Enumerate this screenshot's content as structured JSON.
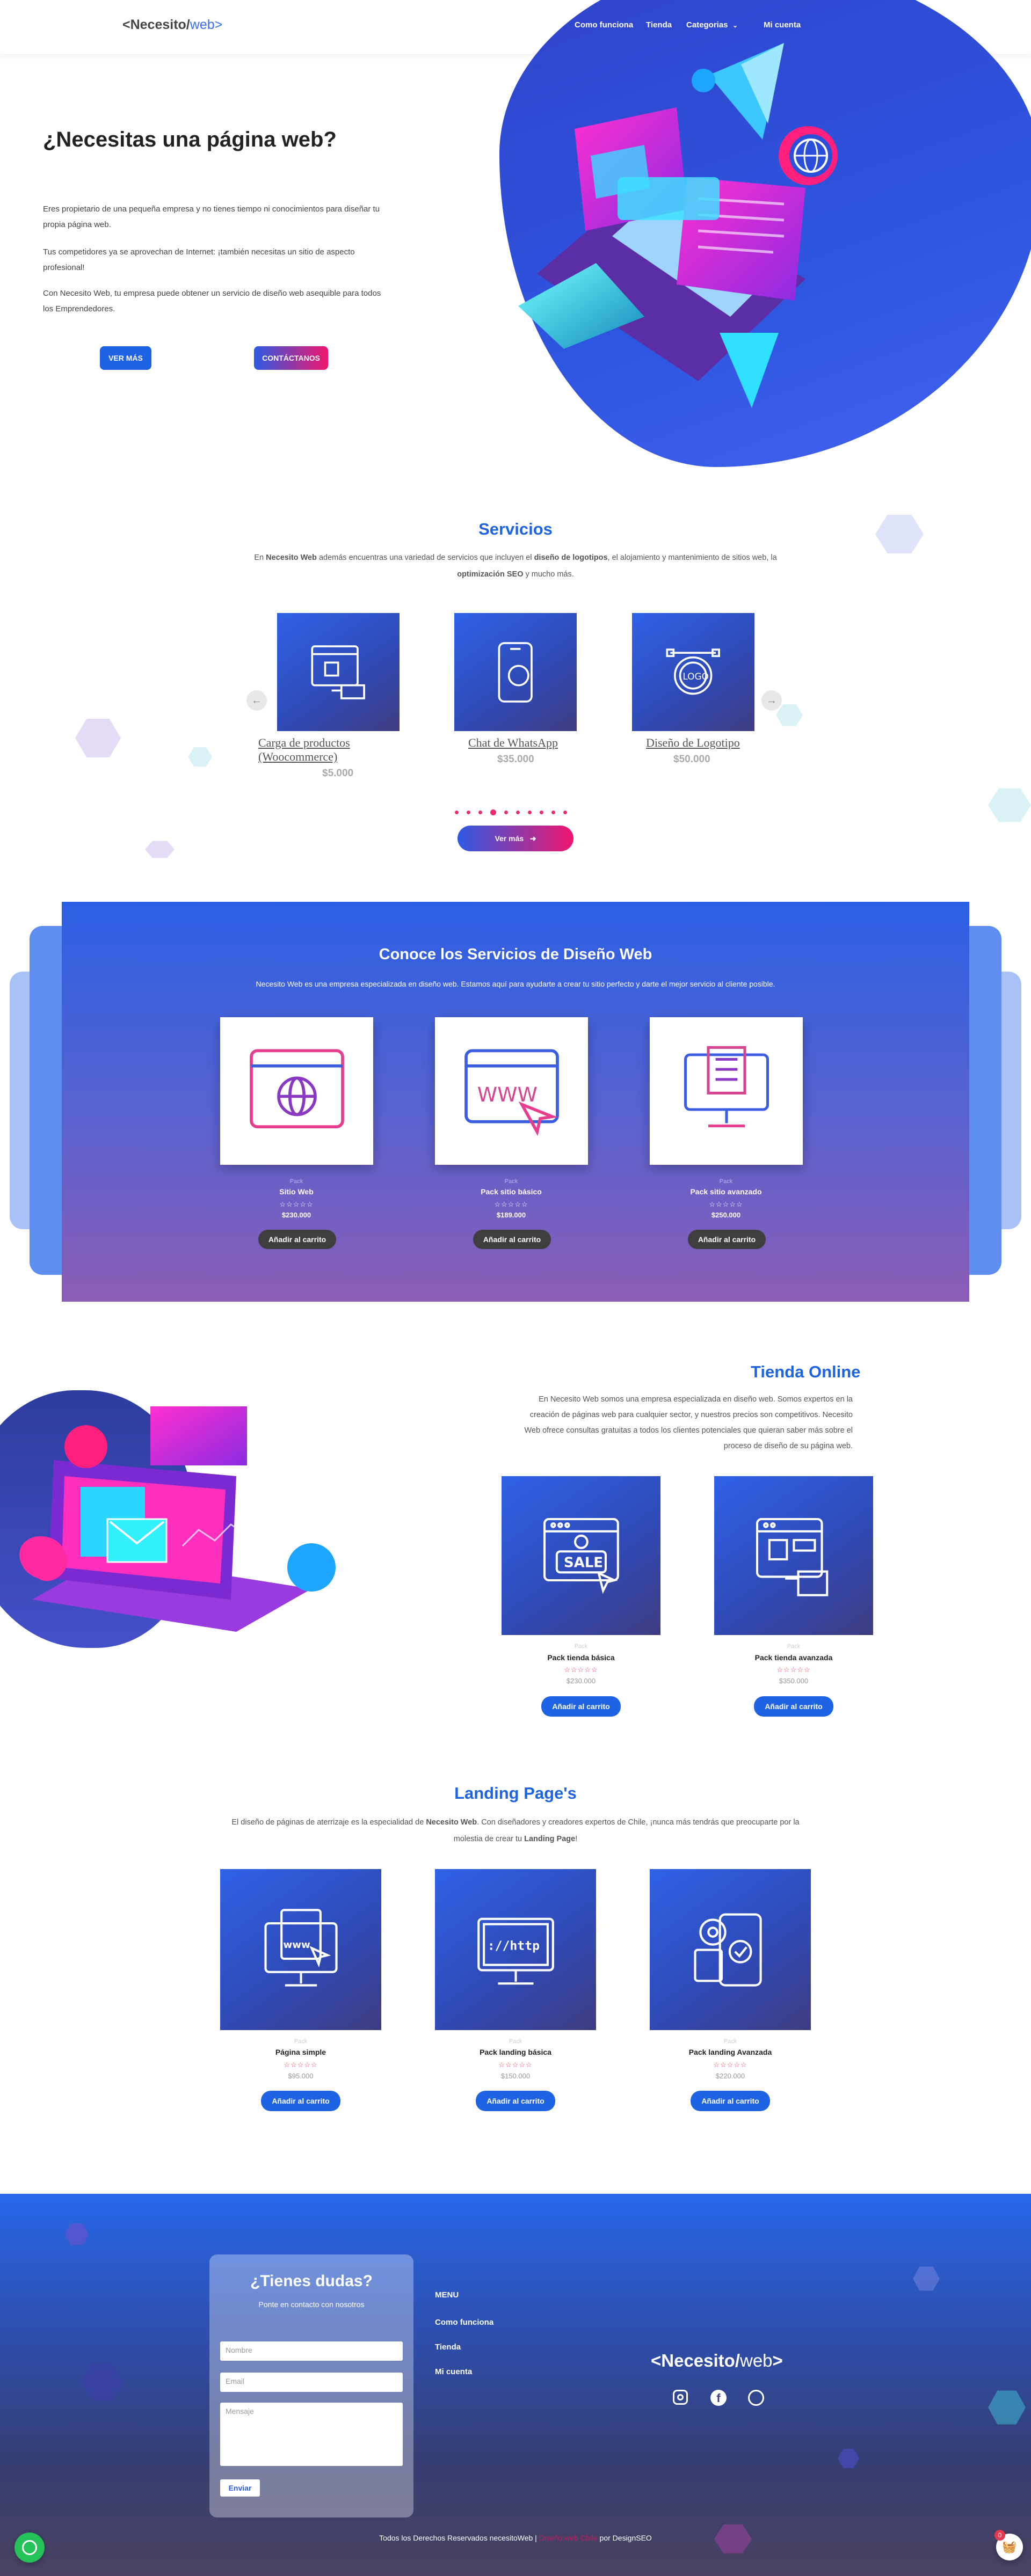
{
  "header": {
    "logo_main": "<Necesito/",
    "logo_web": "web",
    "logo_end": ">",
    "nav": [
      "Como funciona",
      "Tienda",
      "Categorias",
      "Mi cuenta"
    ]
  },
  "hero": {
    "title": "¿Necesitas una página web?",
    "p1": "Eres propietario de una pequeña empresa y no tienes tiempo ni conocimientos para diseñar tu propia página web.",
    "p2": "Tus competidores ya se aprovechan de Internet: ¡también necesitas un sitio de aspecto profesional!",
    "p3": "Con Necesito Web, tu empresa puede obtener un servicio de diseño web asequible para todos los Emprendedores.",
    "btn_more": "VER MÁS",
    "btn_contact": "CONTÁCTANOS"
  },
  "servicios": {
    "title": "Servicios",
    "desc_a": "En ",
    "desc_b": "Necesito Web",
    "desc_c": " además encuentras una variedad de servicios que incluyen el ",
    "desc_d": "diseño de logotipos",
    "desc_e": ", el alojamiento y mantenimiento de sitios web, la",
    "desc_f": "optimización SEO",
    "desc_g": " y mucho más.",
    "items": [
      {
        "name": "Carga de productos (Woocommerce)",
        "price": "$5.000",
        "icon": "shopping-hand-icon"
      },
      {
        "name": "Chat de WhatsApp",
        "price": "$35.000",
        "icon": "whatsapp-phone-icon"
      },
      {
        "name": "Diseño de Logotipo",
        "price": "$50.000",
        "icon": "logo-design-icon"
      }
    ],
    "btn": "Ver más"
  },
  "conoce": {
    "title": "Conoce los Servicios de Diseño Web",
    "desc": "Necesito Web es una empresa especializada en diseño web. Estamos aquí para ayudarte a crear tu sitio perfecto y darte el mejor servicio al cliente posible.",
    "products": [
      {
        "cat": "Pack",
        "name": "Sitio Web",
        "stars": "☆☆☆☆☆",
        "price": "$230.000",
        "btn": "Añadir al carrito",
        "icon": "browser-globe-icon"
      },
      {
        "cat": "Pack",
        "name": "Pack sitio básico",
        "stars": "☆☆☆☆☆",
        "price": "$189.000",
        "btn": "Añadir al carrito",
        "icon": "www-cursor-icon"
      },
      {
        "cat": "Pack",
        "name": "Pack sitio avanzado",
        "stars": "☆☆☆☆☆",
        "price": "$250.000",
        "btn": "Añadir al carrito",
        "icon": "monitor-checklist-icon"
      }
    ]
  },
  "tienda": {
    "title": "Tienda Online",
    "desc": "En Necesito Web somos una empresa especializada en diseño web. Somos expertos en la creación de páginas web para cualquier sector, y nuestros precios son competitivos. Necesito Web ofrece consultas gratuitas a todos los clientes potenciales que quieran saber más sobre el proceso de diseño de su página web.",
    "products": [
      {
        "cat": "Pack",
        "name": "Pack tienda básica",
        "stars": "☆☆☆☆☆",
        "price": "$230.000",
        "btn": "Añadir al carrito",
        "icon": "sale-browser-icon"
      },
      {
        "cat": "Pack",
        "name": "Pack tienda avanzada",
        "stars": "☆☆☆☆☆",
        "price": "$350.000",
        "btn": "Añadir al carrito",
        "icon": "shopping-browser-icon"
      }
    ]
  },
  "landing": {
    "title": "Landing Page's",
    "desc_a": "El diseño de páginas de aterrizaje es la especialidad de ",
    "desc_b": "Necesito Web",
    "desc_c": ". Con diseñadores y creadores expertos de Chile, ¡nunca más tendrás que preocuparte por la",
    "desc_d": "molestia de crear tu ",
    "desc_e": "Landing Page",
    "desc_f": "!",
    "products": [
      {
        "cat": "Pack",
        "name": "Página simple",
        "stars": "☆☆☆☆☆",
        "price": "$95.000",
        "btn": "Añadir al carrito",
        "icon": "monitor-www-icon"
      },
      {
        "cat": "Pack",
        "name": "Pack landing básica",
        "stars": "☆☆☆☆☆",
        "price": "$150.000",
        "btn": "Añadir al carrito",
        "icon": "monitor-http-icon"
      },
      {
        "cat": "Pack",
        "name": "Pack landing Avanzada",
        "stars": "☆☆☆☆☆",
        "price": "$220.000",
        "btn": "Añadir al carrito",
        "icon": "phone-gear-check-icon"
      }
    ]
  },
  "footer": {
    "form_title": "¿Tienes dudas?",
    "form_sub": "Ponte en contacto con nosotros",
    "ph_name": "Nombre",
    "ph_email": "Email",
    "ph_msg": "Mensaje",
    "send": "Enviar",
    "menu_title": "MENU",
    "menu": [
      "Como funciona",
      "Tienda",
      "Mi cuenta"
    ],
    "copyright_a": "Todos los Derechos Reservados necesitoWeb | ",
    "copyright_b": "Diseño web Chile",
    "copyright_c": " por DesignSEO",
    "cart_count": "0"
  },
  "colors": {
    "primary": "#1f63e5",
    "accent": "#f0166e",
    "dark": "#3e3e3e"
  }
}
